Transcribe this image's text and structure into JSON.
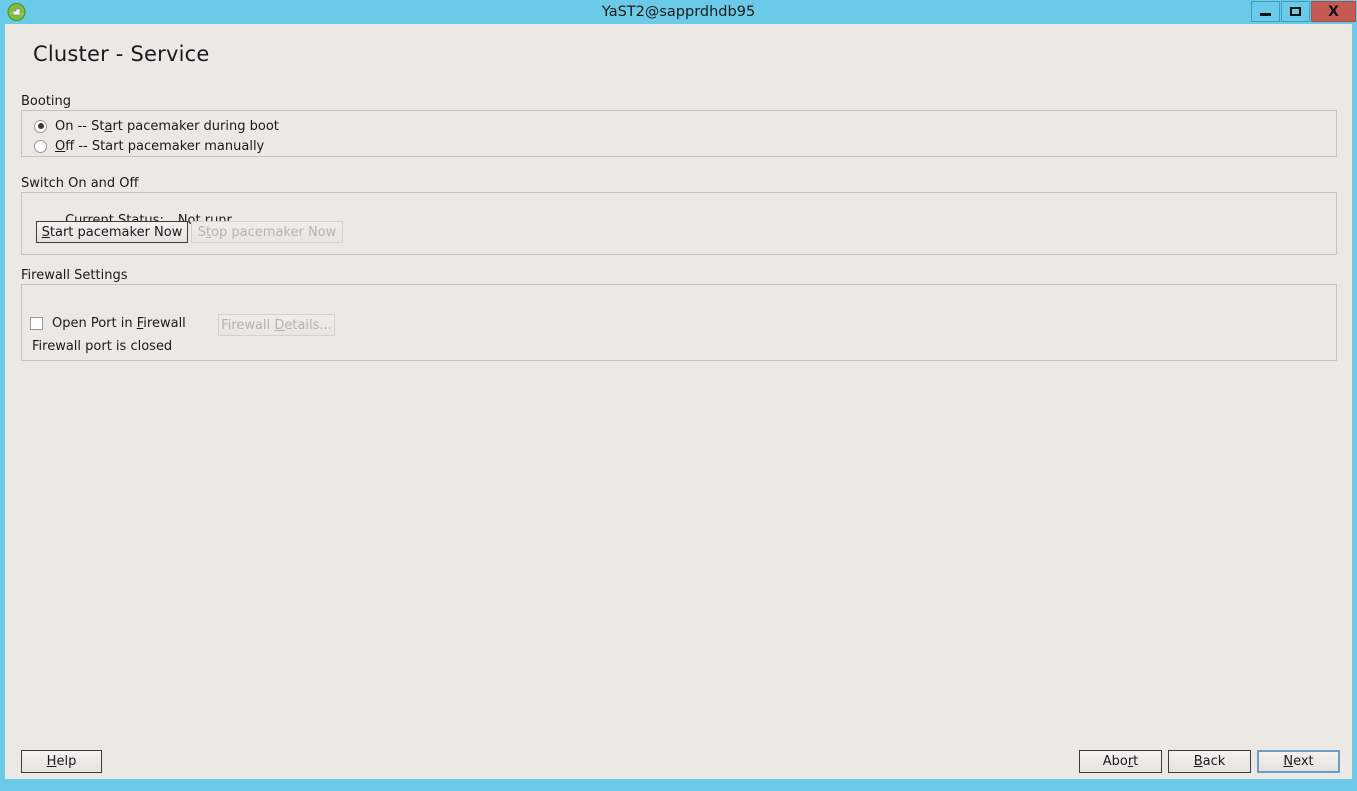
{
  "window": {
    "title": "YaST2@sapprdhdb95",
    "icon": "yast-globe-icon",
    "controls": {
      "minimize": "minimize-icon",
      "maximize": "maximize-icon",
      "close": "X"
    },
    "titlebar_color": "#6bcae8",
    "background_color": "#ece9e4"
  },
  "page": {
    "title": "Cluster - Service"
  },
  "booting": {
    "group_label": "Booting",
    "options": [
      {
        "id": "on",
        "pre": "On -- St",
        "mnemonic": "a",
        "post": "rt pacemaker during boot",
        "selected": true
      },
      {
        "id": "off",
        "pre": "",
        "mnemonic": "O",
        "post": "ff -- Start pacemaker manually",
        "selected": false
      }
    ]
  },
  "switch_section": {
    "group_label": "Switch On and Off",
    "status_label": "Current Status:",
    "status_value": "Not runr",
    "start_button": {
      "pre": "",
      "mnemonic": "S",
      "post": "tart pacemaker Now",
      "enabled": true
    },
    "stop_button": {
      "pre": "S",
      "mnemonic": "t",
      "post": "op pacemaker Now",
      "enabled": false
    }
  },
  "firewall": {
    "group_label": "Firewall Settings",
    "checkbox": {
      "pre": "Open Port in ",
      "mnemonic": "F",
      "post": "irewall",
      "checked": false
    },
    "details_button": {
      "pre": "Firewall ",
      "mnemonic": "D",
      "post": "etails...",
      "enabled": false
    },
    "status_text": "Firewall port is closed"
  },
  "footer": {
    "help": {
      "pre": "",
      "mnemonic": "H",
      "post": "elp"
    },
    "abort": {
      "pre": "Abo",
      "mnemonic": "r",
      "post": "t"
    },
    "back": {
      "pre": "",
      "mnemonic": "B",
      "post": "ack"
    },
    "next": {
      "pre": "",
      "mnemonic": "N",
      "post": "ext",
      "is_default": true
    }
  }
}
